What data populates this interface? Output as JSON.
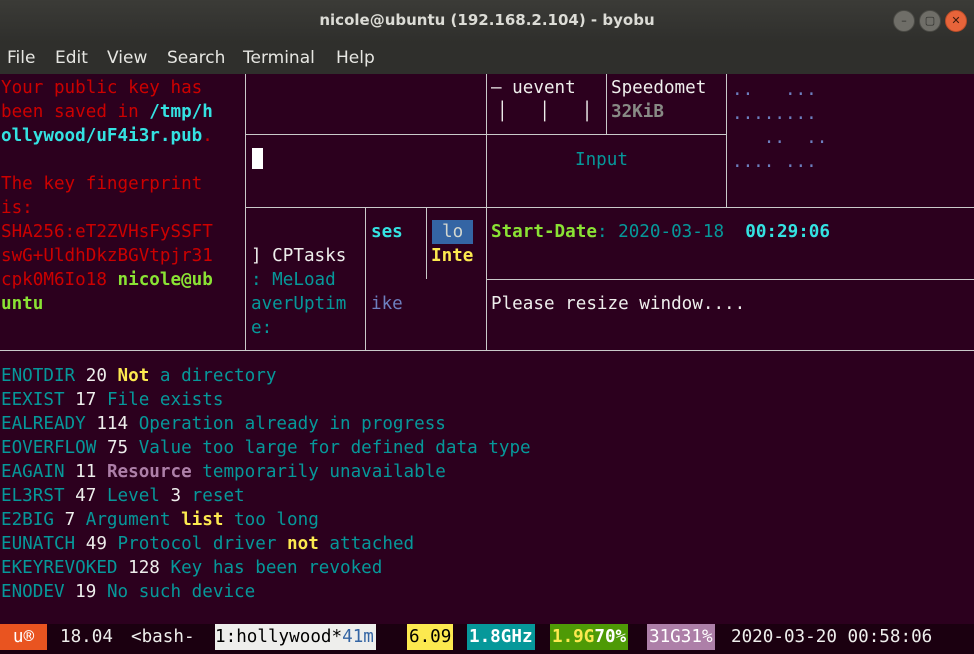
{
  "window": {
    "title": "nicole@ubuntu (192.168.2.104) - byobu",
    "controls": [
      "–",
      "▢",
      "✕"
    ]
  },
  "menu": [
    "File",
    "Edit",
    "View",
    "Search",
    "Terminal",
    "Help"
  ],
  "pane_left": {
    "lines": [
      "Your public key has",
      "been saved in ",
      "/tmp/h",
      "ollywood/uF4i3r.pub",
      ".",
      "The key fingerprint",
      "is:",
      "SHA256:eT2ZVHsFySSFT",
      "swG+UldhDkzBGVtpjr31",
      "cpk0M6Io18 ",
      "nicole@ub",
      "untu"
    ]
  },
  "pane_uevent": {
    "label": "— uevent",
    "bars": "│   │   │"
  },
  "pane_speed": {
    "label": "Speedomet",
    "value": "32KiB"
  },
  "pane_dots": [
    "..   ...",
    "........",
    "   ..  ..",
    ".... ..."
  ],
  "pane_input": {
    "label": "Input"
  },
  "pane_cptasks": {
    "lines": [
      "] CPTasks",
      ": MeLoad",
      "averUptim",
      "e:"
    ]
  },
  "pane_ses": {
    "top": "ses",
    "bottom": "ike"
  },
  "pane_lo": {
    "badge": "lo",
    "text": "Inte"
  },
  "pane_main": {
    "start_label": "Start-Date",
    "start_colon": ":",
    "start_date": "2020-03-18",
    "start_time": "00:29:06",
    "message": "Please resize window...."
  },
  "errors": [
    {
      "code": "ENOTDIR",
      "num": "20",
      "parts": [
        {
          "text": "Not",
          "style": "yellowb"
        },
        {
          "text": " a directory",
          "style": "teal"
        }
      ]
    },
    {
      "code": "EEXIST",
      "num": "17",
      "parts": [
        {
          "text": "File exists",
          "style": "teal"
        }
      ]
    },
    {
      "code": "EALREADY",
      "num": "114",
      "parts": [
        {
          "text": "Operation already in progress",
          "style": "teal"
        }
      ]
    },
    {
      "code": "EOVERFLOW",
      "num": "75",
      "parts": [
        {
          "text": "Value too large for defined data type",
          "style": "teal"
        }
      ]
    },
    {
      "code": "EAGAIN",
      "num": "11",
      "parts": [
        {
          "text": "Resource",
          "style": "magb"
        },
        {
          "text": " temporarily unavailable",
          "style": "teal"
        }
      ]
    },
    {
      "code": "EL3RST",
      "num": "47",
      "parts": [
        {
          "text": "Level ",
          "style": "teal"
        },
        {
          "text": "3",
          "style": "white"
        },
        {
          "text": " reset",
          "style": "teal"
        }
      ]
    },
    {
      "code": "E2BIG",
      "num": "7",
      "parts": [
        {
          "text": "Argument ",
          "style": "teal"
        },
        {
          "text": "list",
          "style": "yellowb"
        },
        {
          "text": " too long",
          "style": "teal"
        }
      ]
    },
    {
      "code": "EUNATCH",
      "num": "49",
      "parts": [
        {
          "text": "Protocol driver ",
          "style": "teal"
        },
        {
          "text": "not",
          "style": "yellowb"
        },
        {
          "text": " attached",
          "style": "teal"
        }
      ]
    },
    {
      "code": "EKEYREVOKED",
      "num": "128",
      "parts": [
        {
          "text": "Key has been revoked",
          "style": "teal"
        }
      ]
    },
    {
      "code": "ENODEV",
      "num": "19",
      "parts": [
        {
          "text": "No such device",
          "style": "teal"
        }
      ]
    }
  ],
  "statusbar": {
    "logo": "u®",
    "release": "18.04",
    "session": "<bash-",
    "window_num": "1:",
    "window_name": "hollywood",
    "window_flag": "*",
    "window_age": "41m",
    "load": "6.09",
    "cpu_freq": "1.8GHz",
    "mem_total": "1.9G",
    "mem_used": "70%",
    "disk_total": "31G",
    "disk_used": "31%",
    "datetime": "2020-03-20 00:58:06"
  },
  "colors": {
    "terminal_bg": "#2c001e",
    "ubuntu_orange": "#e95420",
    "load_yellow": "#fce94f",
    "cpu_teal": "#06989a",
    "mem_green": "#4e9a06",
    "disk_purple": "#ad7fa8"
  }
}
